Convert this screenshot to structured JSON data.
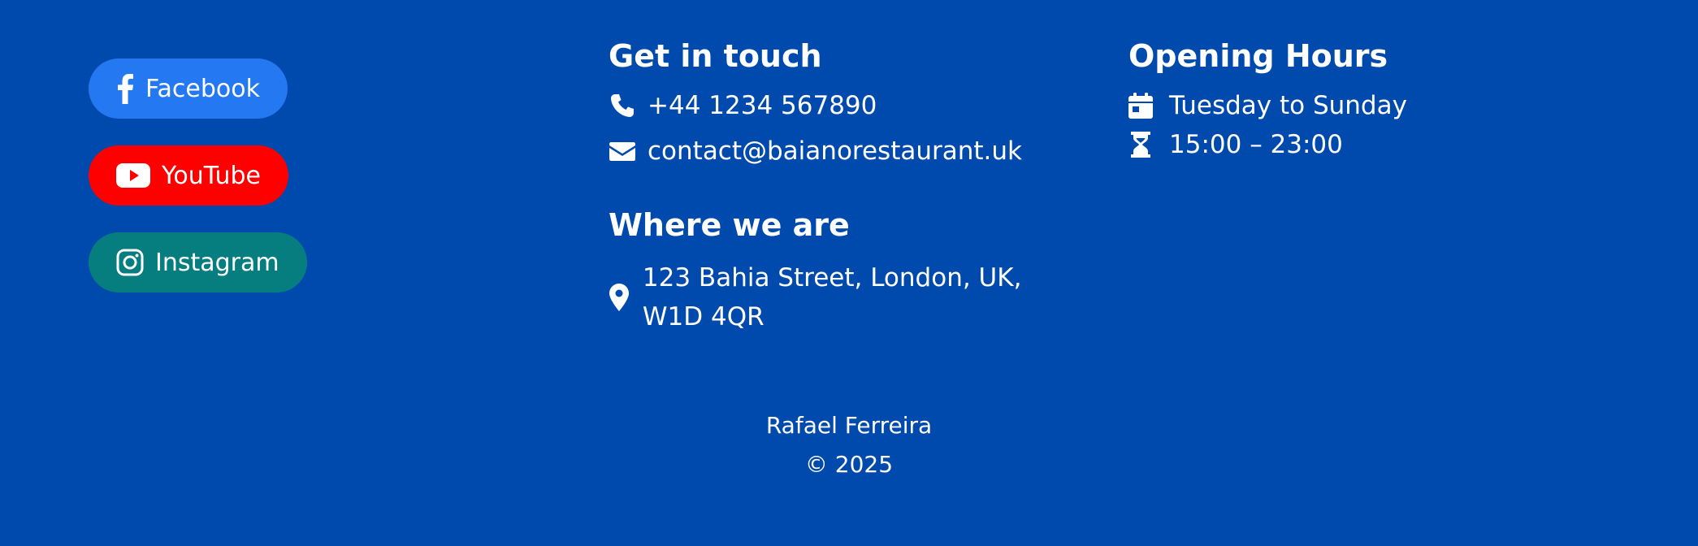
{
  "social": {
    "facebook": {
      "label": "Facebook",
      "color": "#2478f2",
      "icon": "facebook-icon"
    },
    "youtube": {
      "label": "YouTube",
      "color": "#ff0000",
      "icon": "youtube-icon"
    },
    "instagram": {
      "label": "Instagram",
      "color": "#067d7e",
      "icon": "instagram-icon"
    }
  },
  "contact": {
    "heading": "Get in touch",
    "phone": "+44 1234 567890",
    "email": "contact@baianorestaurant.uk"
  },
  "location": {
    "heading": "Where we are",
    "address": "123 Bahia Street, London, UK, W1D 4QR"
  },
  "hours": {
    "heading": "Opening Hours",
    "days": "Tuesday to Sunday",
    "time": "15:00 – 23:00"
  },
  "credit": {
    "name": "Rafael Ferreira",
    "copyright": "© 2025"
  },
  "colors": {
    "background": "#004aad",
    "text": "#ffffff"
  }
}
